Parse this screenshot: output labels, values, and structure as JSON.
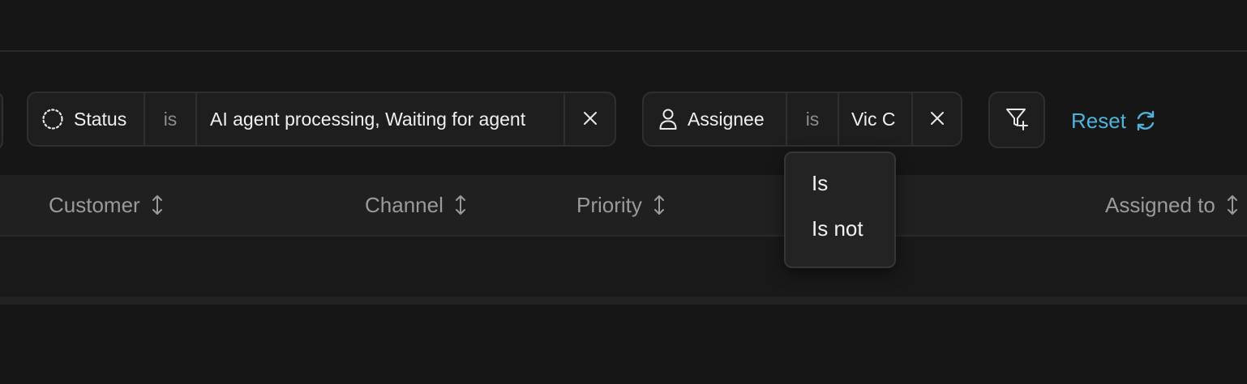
{
  "filters": [
    {
      "field_icon": "dotted-circle-icon",
      "field": "Status",
      "operator": "is",
      "value": "AI agent processing, Waiting for agent",
      "remove_icon": "close-icon"
    },
    {
      "field_icon": "person-icon",
      "field": "Assignee",
      "operator": "is",
      "value": "Vic C",
      "remove_icon": "close-icon"
    }
  ],
  "add_filter_icon": "filter-plus-icon",
  "reset": {
    "label": "Reset",
    "icon": "refresh-icon",
    "color": "#4fb3d9"
  },
  "table": {
    "columns": [
      {
        "label": "Customer",
        "sort_icon": "sort-arrows-icon"
      },
      {
        "label": "Channel",
        "sort_icon": "sort-arrows-icon"
      },
      {
        "label": "Priority",
        "sort_icon": "sort-arrows-icon"
      },
      {
        "label": "Assigned to",
        "sort_icon": "sort-arrows-icon"
      }
    ]
  },
  "operator_dropdown": {
    "options": [
      "Is",
      "Is not"
    ]
  },
  "colors": {
    "background": "#161616",
    "accent": "#4fb3d9",
    "chip_background": "#1e1e1e",
    "header_background": "#202020"
  }
}
